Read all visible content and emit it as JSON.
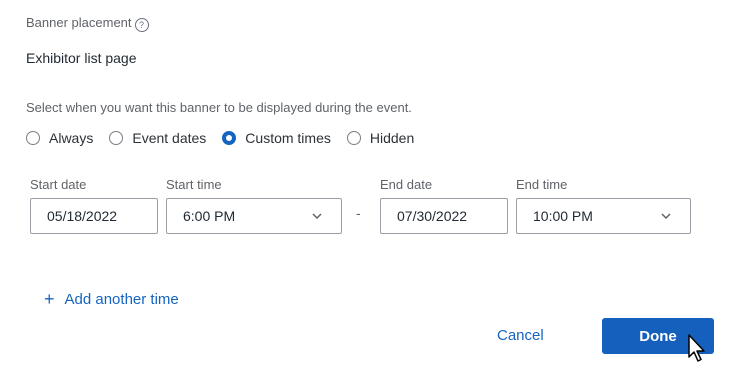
{
  "placement": {
    "label": "Banner placement",
    "help_icon": "question-circle-icon",
    "value": "Exhibitor list page"
  },
  "display": {
    "instruction": "Select when you want this banner to be displayed during the event.",
    "options": [
      {
        "label": "Always",
        "selected": false
      },
      {
        "label": "Event dates",
        "selected": false
      },
      {
        "label": "Custom times",
        "selected": true
      },
      {
        "label": "Hidden",
        "selected": false
      }
    ]
  },
  "schedule": {
    "start_date_label": "Start date",
    "start_date_value": "05/18/2022",
    "start_time_label": "Start time",
    "start_time_value": "6:00 PM",
    "separator": "-",
    "end_date_label": "End date",
    "end_date_value": "07/30/2022",
    "end_time_label": "End time",
    "end_time_value": "10:00 PM"
  },
  "add_time": {
    "icon": "plus-icon",
    "label": "Add another time"
  },
  "footer": {
    "cancel_label": "Cancel",
    "done_label": "Done"
  },
  "colors": {
    "accent": "#1565c0",
    "primary_button": "#1560bd"
  }
}
